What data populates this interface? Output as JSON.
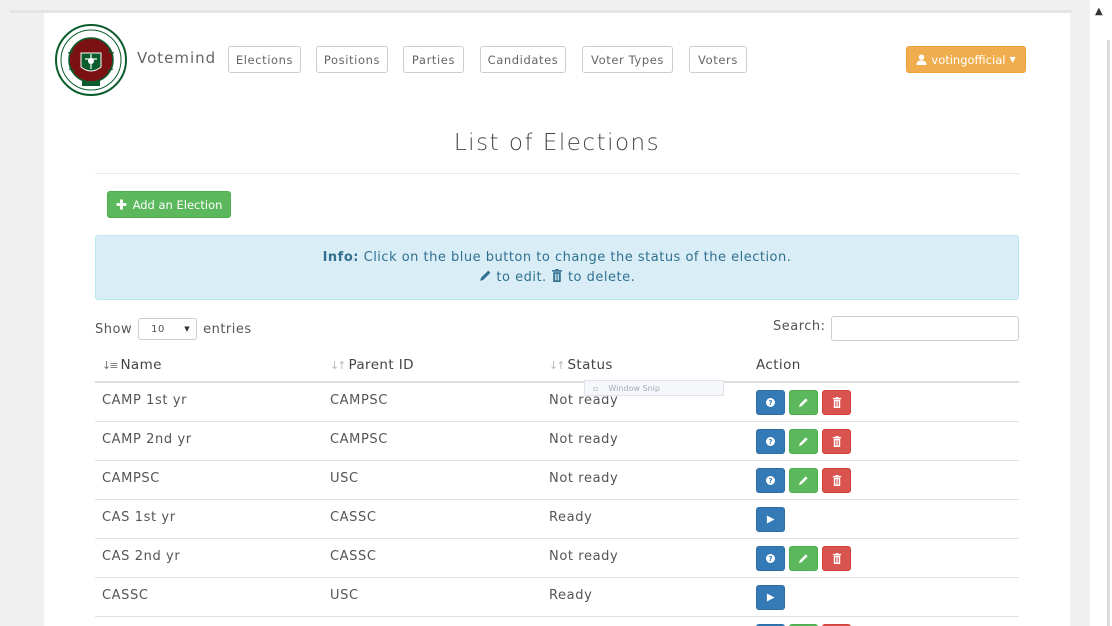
{
  "brand": {
    "name": "Votemind"
  },
  "nav": [
    {
      "label": "Elections"
    },
    {
      "label": "Positions"
    },
    {
      "label": "Parties"
    },
    {
      "label": "Candidates"
    },
    {
      "label": "Voter Types"
    },
    {
      "label": "Voters"
    }
  ],
  "user": {
    "name": "votingofficial"
  },
  "page": {
    "title": "List of Elections"
  },
  "toolbar": {
    "add_label": "Add an Election"
  },
  "info": {
    "strong": "Info:",
    "line1": " Click on the blue button to change the status of the election.",
    "edit_text": " to edit. ",
    "delete_text": " to delete."
  },
  "table_controls": {
    "show_label": "Show",
    "entries_value": "10",
    "entries_label": "entries",
    "search_label": "Search:"
  },
  "table": {
    "headers": {
      "name": "Name",
      "parent": "Parent ID",
      "status": "Status",
      "action": "Action"
    },
    "rows": [
      {
        "name": "CAMP 1st yr",
        "parent": "CAMPSC",
        "status": "Not ready"
      },
      {
        "name": "CAMP 2nd yr",
        "parent": "CAMPSC",
        "status": "Not ready"
      },
      {
        "name": "CAMPSC",
        "parent": "USC",
        "status": "Not ready"
      },
      {
        "name": "CAS 1st yr",
        "parent": "CASSC",
        "status": "Ready"
      },
      {
        "name": "CAS 2nd yr",
        "parent": "CASSC",
        "status": "Not ready"
      },
      {
        "name": "CASSC",
        "parent": "USC",
        "status": "Ready"
      }
    ]
  },
  "overlay": {
    "snip_label": "Window Snip"
  },
  "colors": {
    "primary": "#337ab7",
    "success": "#5cb85c",
    "danger": "#d9534f",
    "warning": "#f0ad4e",
    "info_bg": "#d9edf7",
    "logo_maroon": "#7b1113",
    "logo_green": "#0b5d2e"
  },
  "icons": {
    "add": "plus-icon",
    "user": "user-icon",
    "edit": "pencil-icon",
    "delete": "trash-icon",
    "status": "question-icon",
    "start": "play-icon"
  }
}
